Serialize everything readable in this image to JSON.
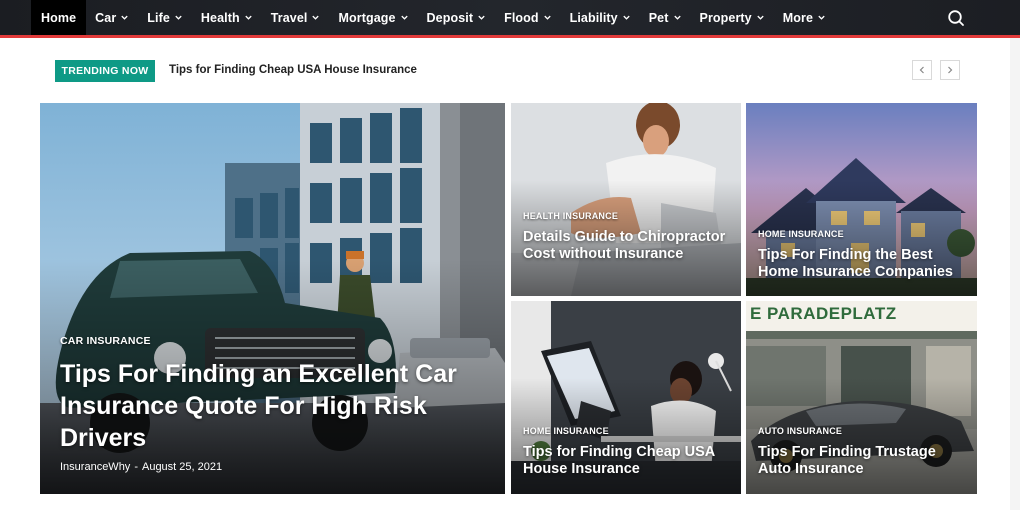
{
  "nav": {
    "items": [
      {
        "label": "Home",
        "active": true,
        "dropdown": false
      },
      {
        "label": "Car",
        "dropdown": true
      },
      {
        "label": "Life",
        "dropdown": true
      },
      {
        "label": "Health",
        "dropdown": true
      },
      {
        "label": "Travel",
        "dropdown": true
      },
      {
        "label": "Mortgage",
        "dropdown": true
      },
      {
        "label": "Deposit",
        "dropdown": true
      },
      {
        "label": "Flood",
        "dropdown": true
      },
      {
        "label": "Liability",
        "dropdown": true
      },
      {
        "label": "Pet",
        "dropdown": true
      },
      {
        "label": "Property",
        "dropdown": true
      },
      {
        "label": "More",
        "dropdown": true
      }
    ],
    "search_icon": "search-icon",
    "accent_color": "#e23a3a"
  },
  "trending": {
    "badge": "TRENDING NOW",
    "headline": "Tips for Finding Cheap USA House Insurance",
    "prev_icon": "chevron-left-icon",
    "next_icon": "chevron-right-icon",
    "badge_color": "#0e9a86"
  },
  "posts": {
    "main": {
      "category": "CAR INSURANCE",
      "title": "Tips For Finding an Excellent Car Insurance Quote For High Risk Drivers",
      "author": "InsuranceWhy",
      "separator": "-",
      "date": "August 25, 2021"
    },
    "chiro": {
      "category": "HEALTH INSURANCE",
      "title": "Details Guide to Chiropractor Cost without Insurance"
    },
    "home_best": {
      "category": "HOME INSURANCE",
      "title": "Tips For Finding the Best Home Insurance Companies"
    },
    "house_usa": {
      "category": "HOME INSURANCE",
      "title": "Tips for Finding Cheap USA House Insurance"
    },
    "auto": {
      "category": "AUTO INSURANCE",
      "title": "Tips For Finding Trustage Auto Insurance"
    }
  },
  "images": {
    "auto_storefront_sign": "E PARADEPLATZ"
  }
}
